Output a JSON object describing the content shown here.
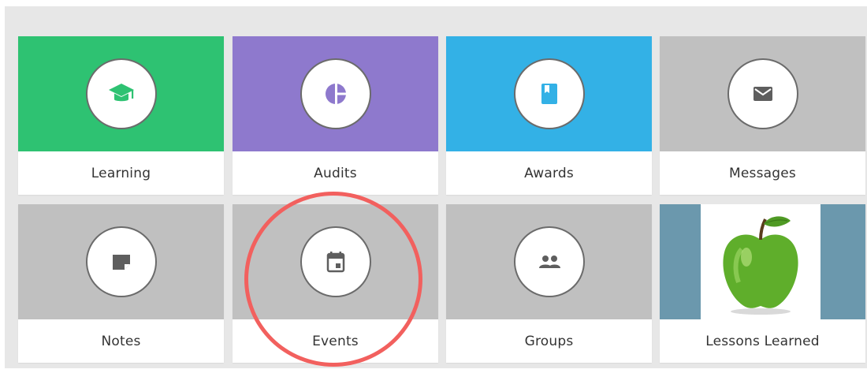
{
  "tiles": [
    {
      "label": "Learning",
      "color": "#2ec272",
      "icon": "graduation-cap-icon"
    },
    {
      "label": "Audits",
      "color": "#8e79cd",
      "icon": "pie-chart-icon"
    },
    {
      "label": "Awards",
      "color": "#33b1e6",
      "icon": "book-icon"
    },
    {
      "label": "Messages",
      "color": "#c0c0c0",
      "icon": "envelope-icon"
    },
    {
      "label": "Notes",
      "color": "#c0c0c0",
      "icon": "note-icon"
    },
    {
      "label": "Events",
      "color": "#c0c0c0",
      "icon": "calendar-icon"
    },
    {
      "label": "Groups",
      "color": "#c0c0c0",
      "icon": "people-icon"
    },
    {
      "label": "Lessons Learned",
      "color": "#6b98ad",
      "icon": "green-apple-image"
    }
  ],
  "highlight": {
    "target": "Events",
    "color": "#f2605e"
  }
}
